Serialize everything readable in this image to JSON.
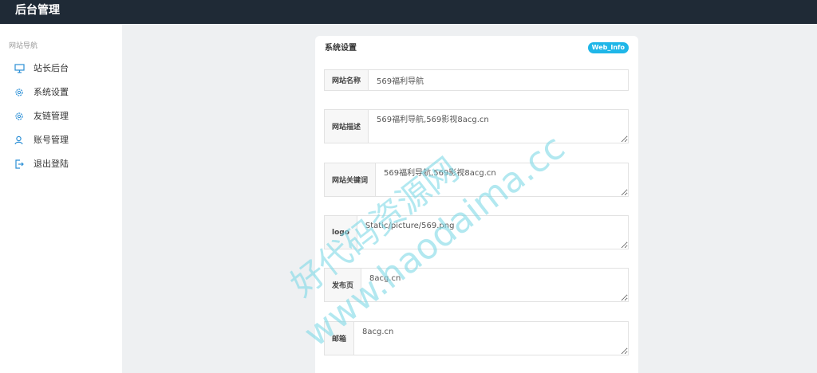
{
  "app": {
    "title": "后台管理"
  },
  "sidebar": {
    "section_label": "网站导航",
    "items": [
      {
        "label": "站长后台",
        "icon": "monitor-icon"
      },
      {
        "label": "系统设置",
        "icon": "gear-icon"
      },
      {
        "label": "友链管理",
        "icon": "gear-icon"
      },
      {
        "label": "账号管理",
        "icon": "user-icon"
      },
      {
        "label": "退出登陆",
        "icon": "logout-icon"
      }
    ]
  },
  "panel": {
    "title": "系统设置",
    "badge": "Web_Info",
    "fields": [
      {
        "label": "网站名称",
        "value": "569福利导航"
      },
      {
        "label": "网站描述",
        "value": "569福利导航,569影视8acg.cn"
      },
      {
        "label": "网站关键词",
        "value": "569福利导航,569影视8acg.cn"
      },
      {
        "label": "logo",
        "value": "Static/picture/569.png"
      },
      {
        "label": "发布页",
        "value": "8acg.cn"
      },
      {
        "label": "邮箱",
        "value": "8acg.cn"
      }
    ]
  },
  "watermark": {
    "line1": "好代码资源网",
    "line2": "www.haodaima.cc"
  },
  "colors": {
    "topbar": "#1f2a36",
    "badge": "#1fb6e8",
    "watermark": "#7fd8e6"
  }
}
